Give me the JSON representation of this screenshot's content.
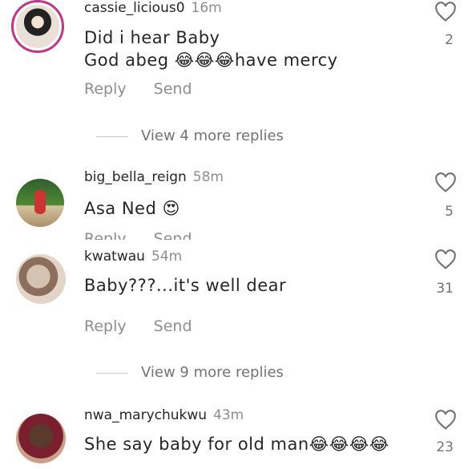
{
  "comments": [
    {
      "username": "cassie_licious0",
      "time": "16m",
      "lines": [
        "Did i hear Baby",
        "God abeg 😂😂😂have mercy"
      ],
      "likes": "2",
      "reply": "Reply",
      "send": "Send",
      "view_more": "View 4 more replies"
    },
    {
      "username": "big_bella_reign",
      "time": "58m",
      "lines": [
        "Asa Ned 😍"
      ],
      "likes": "5",
      "reply": "Reply",
      "send": "Send"
    },
    {
      "username": "kwatwau",
      "time": "54m",
      "lines": [
        "Baby???...it's well dear"
      ],
      "likes": "31",
      "reply": "Reply",
      "send": "Send",
      "view_more": "View 9 more replies"
    },
    {
      "username": "nwa_marychukwu",
      "time": "43m",
      "lines": [
        "She say baby for old man😂😂😂😂"
      ],
      "likes": "23"
    }
  ],
  "icons": {
    "like": "heart-outline-icon"
  },
  "colors": {
    "story_ring": "#c13584",
    "secondary_text": "#8e8e8e"
  }
}
